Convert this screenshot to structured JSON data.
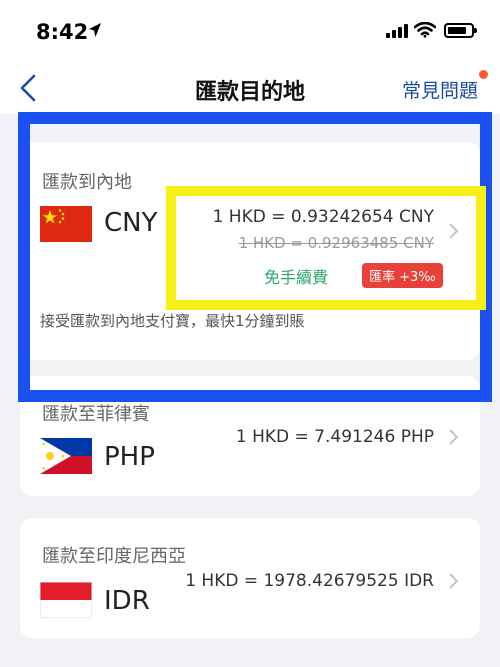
{
  "status_bar": {
    "time": "8:42",
    "location_icon": "location-arrow-icon",
    "signal_icon": "cellular-signal-icon",
    "wifi_icon": "wifi-icon",
    "battery_icon": "battery-icon"
  },
  "nav": {
    "back_icon": "chevron-left-icon",
    "title": "匯款目的地",
    "faq_label": "常見問題"
  },
  "destinations": [
    {
      "title": "匯款到內地",
      "currency": "CNY",
      "rate": "1 HKD = 0.93242654 CNY",
      "old_rate": "1 HKD = 0.92963485 CNY",
      "fee_label": "免手續費",
      "badge": "匯率 +3‰",
      "description": "接受匯款到內地支付寶，最快1分鐘到賬"
    },
    {
      "title": "匯款至菲律賓",
      "currency": "PHP",
      "rate": "1 HKD = 7.491246 PHP"
    },
    {
      "title": "匯款至印度尼西亞",
      "currency": "IDR",
      "rate": "1 HKD = 1978.42679525 IDR"
    }
  ],
  "colors": {
    "accent": "#1a4ca6",
    "fee_green": "#2aa86a",
    "badge_red": "#e8413a",
    "highlight_blue": "#1b50f0",
    "highlight_yellow": "#f6ef1a"
  }
}
